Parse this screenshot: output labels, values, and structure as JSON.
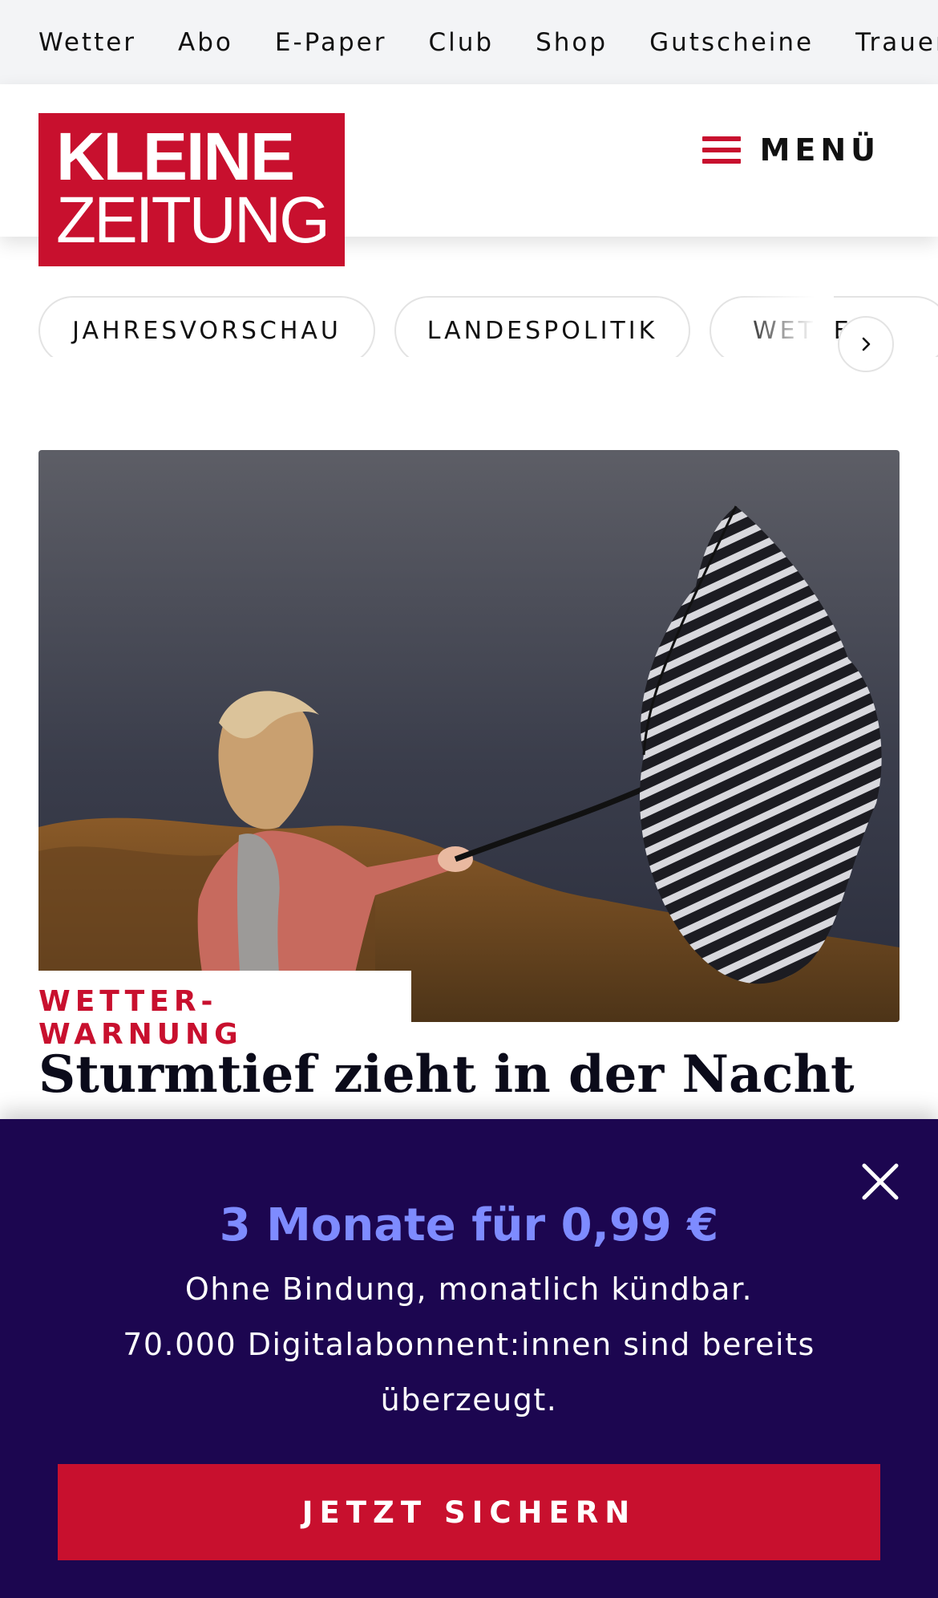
{
  "topnav": {
    "items": [
      "Wetter",
      "Abo",
      "E-Paper",
      "Club",
      "Shop",
      "Gutscheine",
      "Trauerportal"
    ]
  },
  "header": {
    "logo_line1": "KLEINE",
    "logo_line2": "ZEITUNG",
    "menu_label": "MENÜ",
    "brand_color": "#c8102e"
  },
  "chips": {
    "items": [
      "JAHRESVORSCHAU",
      "LANDESPOLITIK",
      "WETTER"
    ],
    "next_icon": "chevron-right-icon"
  },
  "article": {
    "kicker": "WETTER-WARNUNG",
    "headline": "Sturmtief zieht in der Nacht"
  },
  "banner": {
    "offer": "3 Monate für 0,99 €",
    "line1": "Ohne Bindung, monatlich kündbar.",
    "line2": "70.000 Digitalabonnent:innen sind bereits überzeugt.",
    "cta": "JETZT SICHERN",
    "close_icon": "close-icon",
    "background": "#1c0650",
    "accent": "#7e8bff"
  }
}
